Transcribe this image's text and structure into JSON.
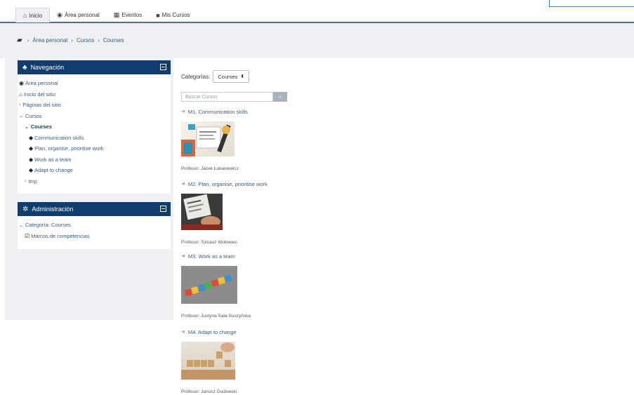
{
  "nav": {
    "items": [
      {
        "label": "Inicio",
        "icon": "home-icon"
      },
      {
        "label": "Área personal",
        "icon": "dashboard-icon"
      },
      {
        "label": "Eventos",
        "icon": "calendar-icon"
      },
      {
        "label": "Mis Cursos",
        "icon": "briefcase-icon"
      }
    ]
  },
  "breadcrumb": [
    "Área personal",
    "Cursos",
    "Courses"
  ],
  "navigation_block": {
    "title": "Navegación",
    "items": [
      {
        "label": "Área personal"
      },
      {
        "label": "Inicio del sitio"
      },
      {
        "label": "Páginas del sitio"
      },
      {
        "label": "Cursos"
      },
      {
        "label": "Courses"
      },
      {
        "label": "Communication skills"
      },
      {
        "label": "Plan, organise, prioritise work"
      },
      {
        "label": "Work as a team"
      },
      {
        "label": "Adapt to change"
      },
      {
        "label": "tmp"
      }
    ]
  },
  "admin_block": {
    "title": "Administración",
    "items": [
      {
        "label": "Categoría: Courses"
      },
      {
        "label": "Marcos de competencias"
      }
    ]
  },
  "main": {
    "category_label": "Categorías:",
    "category_value": "Courses",
    "search_placeholder": "Buscar Cursos",
    "courses": [
      {
        "title": "M1. Communication skills",
        "teacher": "Profesor: Jacek Łukasiewicz"
      },
      {
        "title": "M2. Plan, organise, prioritise work",
        "teacher": "Profesor: Tomasz Wołowiec"
      },
      {
        "title": "M3. Work as a team",
        "teacher": "Profesor: Justyna Sala-Suszyńska"
      },
      {
        "title": "M4. Adapt to change",
        "teacher": "Profesor: Janusz Gudowski"
      }
    ]
  },
  "colors": {
    "header_blue": "#0f3e6e",
    "link": "#3b5b7c",
    "panel_bg": "#eef0f3"
  }
}
